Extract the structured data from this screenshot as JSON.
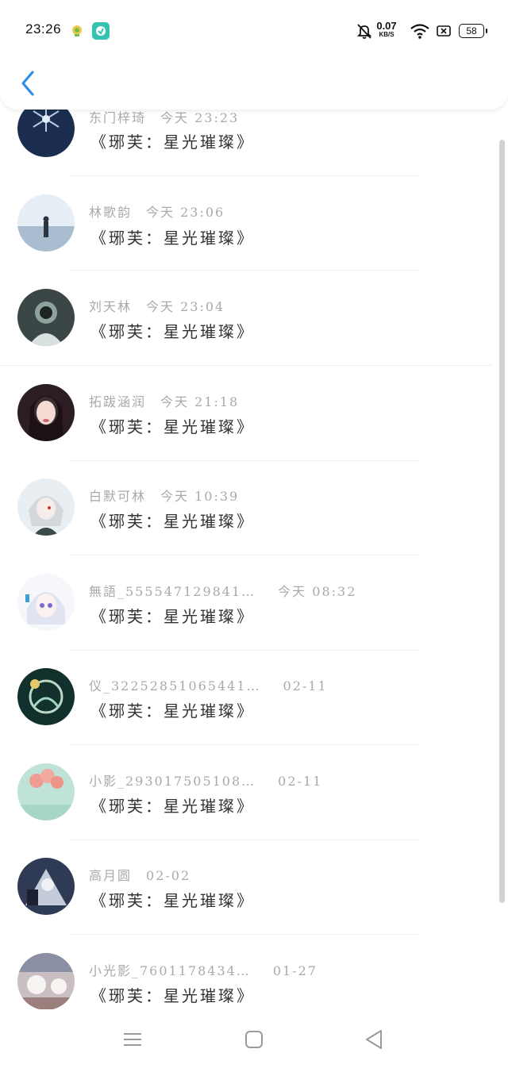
{
  "status_bar": {
    "time": "23:26",
    "net_speed": "0.07",
    "net_unit": "KB/S",
    "battery": "58",
    "icons": [
      "notification-app-icon",
      "chat-app-icon",
      "bell-off-icon",
      "wifi-icon",
      "sim-off-icon",
      "battery-icon"
    ]
  },
  "header": {
    "back_icon": "chevron-left-icon"
  },
  "list": [
    {
      "name": "东门梓琦",
      "date": "今天 23:23",
      "title": "《琊芙：星光璀璨》"
    },
    {
      "name": "林歌韵",
      "date": "今天 23:06",
      "title": "《琊芙：星光璀璨》"
    },
    {
      "name": "刘天林",
      "date": "今天 23:04",
      "title": "《琊芙：星光璀璨》"
    },
    {
      "name": "拓跋涵润",
      "date": "今天 21:18",
      "title": "《琊芙：星光璀璨》"
    },
    {
      "name": "白默可林",
      "date": "今天 10:39",
      "title": "《琊芙：星光璀璨》"
    },
    {
      "name": "無語_5555471298​41…",
      "date": "今天 08:32",
      "title": "《琊芙：星光璀璨》"
    },
    {
      "name": "仪_3225285106544​1…",
      "date": "02-11",
      "title": "《琊芙：星光璀璨》"
    },
    {
      "name": "小影_2930175051​08…",
      "date": "02-11",
      "title": "《琊芙：星光璀璨》"
    },
    {
      "name": "高月圆",
      "date": "02-02",
      "title": "《琊芙：星光璀璨》"
    },
    {
      "name": "小光影_7601178434…",
      "date": "01-27",
      "title": "《琊芙：星光璀璨》"
    }
  ],
  "navbar": {
    "icons": [
      "menu-icon",
      "home-square-icon",
      "back-triangle-icon"
    ]
  }
}
